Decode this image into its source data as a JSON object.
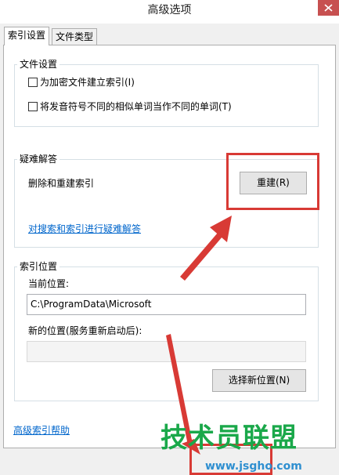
{
  "window": {
    "title": "高级选项"
  },
  "tabs": [
    {
      "label": "索引设置"
    },
    {
      "label": "文件类型"
    }
  ],
  "file_settings": {
    "title": "文件设置",
    "option1": "为加密文件建立索引(I)",
    "option2": "将发音符号不同的相似单词当作不同的单词(T)"
  },
  "troubleshoot": {
    "title": "疑难解答",
    "rebuild_text": "删除和重建索引",
    "rebuild_button": "重建(R)",
    "link": "对搜索和索引进行疑难解答"
  },
  "index_location": {
    "title": "索引位置",
    "current_label": "当前位置:",
    "current_value": "C:\\ProgramData\\Microsoft",
    "new_label": "新的位置(服务重新启动后):",
    "new_value": "",
    "select_button": "选择新位置(N)"
  },
  "footer": {
    "help_link": "高级索引帮助"
  },
  "watermark": {
    "brand": "技术员联盟",
    "url": "www.jsgho.com"
  },
  "colors": {
    "annotation_red": "#d83a35",
    "link_blue": "#0066cc",
    "watermark_green": "#1aa84a"
  }
}
